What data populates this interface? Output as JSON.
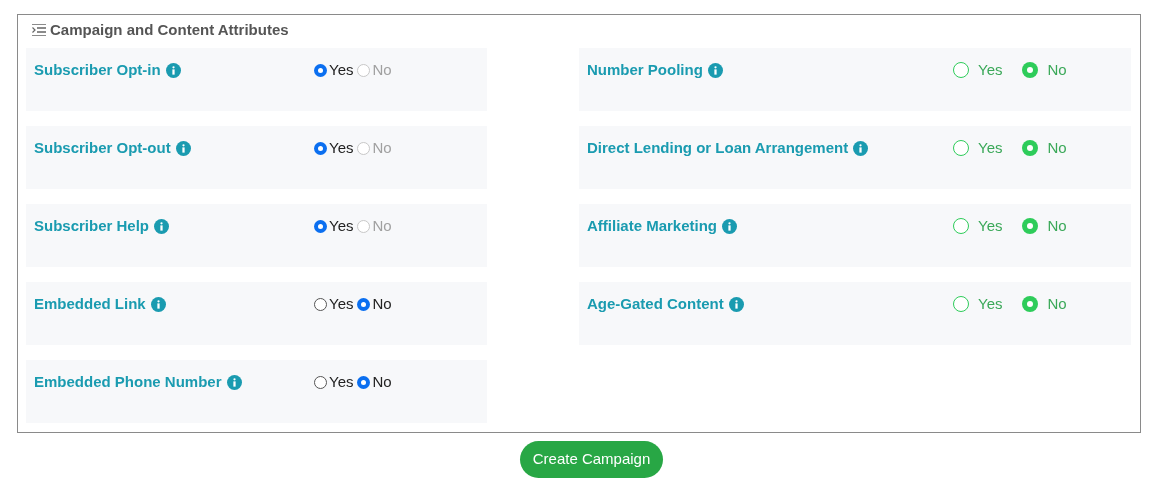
{
  "section": {
    "title": "Campaign and Content Attributes"
  },
  "left_attributes": [
    {
      "label": "Subscriber Opt-in",
      "kind": "native",
      "options": [
        {
          "label": "Yes",
          "selected": true,
          "disabled": false
        },
        {
          "label": "No",
          "selected": false,
          "disabled": true
        }
      ]
    },
    {
      "label": "Subscriber Opt-out",
      "kind": "native",
      "options": [
        {
          "label": "Yes",
          "selected": true,
          "disabled": false
        },
        {
          "label": "No",
          "selected": false,
          "disabled": true
        }
      ]
    },
    {
      "label": "Subscriber Help",
      "kind": "native",
      "options": [
        {
          "label": "Yes",
          "selected": true,
          "disabled": false
        },
        {
          "label": "No",
          "selected": false,
          "disabled": true
        }
      ]
    },
    {
      "label": "Embedded Link",
      "kind": "native",
      "options": [
        {
          "label": "Yes",
          "selected": false,
          "disabled": false
        },
        {
          "label": "No",
          "selected": true,
          "disabled": false
        }
      ]
    },
    {
      "label": "Embedded Phone Number",
      "kind": "native",
      "options": [
        {
          "label": "Yes",
          "selected": false,
          "disabled": false
        },
        {
          "label": "No",
          "selected": true,
          "disabled": false
        }
      ]
    }
  ],
  "right_attributes": [
    {
      "label": "Number Pooling",
      "kind": "custom",
      "options": [
        {
          "label": "Yes",
          "selected": false,
          "disabled": false
        },
        {
          "label": "No",
          "selected": true,
          "disabled": false
        }
      ]
    },
    {
      "label": "Direct Lending or Loan Arrangement",
      "kind": "custom",
      "options": [
        {
          "label": "Yes",
          "selected": false,
          "disabled": false
        },
        {
          "label": "No",
          "selected": true,
          "disabled": false
        }
      ]
    },
    {
      "label": "Affiliate Marketing",
      "kind": "custom",
      "options": [
        {
          "label": "Yes",
          "selected": false,
          "disabled": false
        },
        {
          "label": "No",
          "selected": true,
          "disabled": false
        }
      ]
    },
    {
      "label": "Age-Gated Content",
      "kind": "custom",
      "options": [
        {
          "label": "Yes",
          "selected": false,
          "disabled": false
        },
        {
          "label": "No",
          "selected": true,
          "disabled": false
        }
      ]
    }
  ],
  "submit_button": "Create Campaign"
}
